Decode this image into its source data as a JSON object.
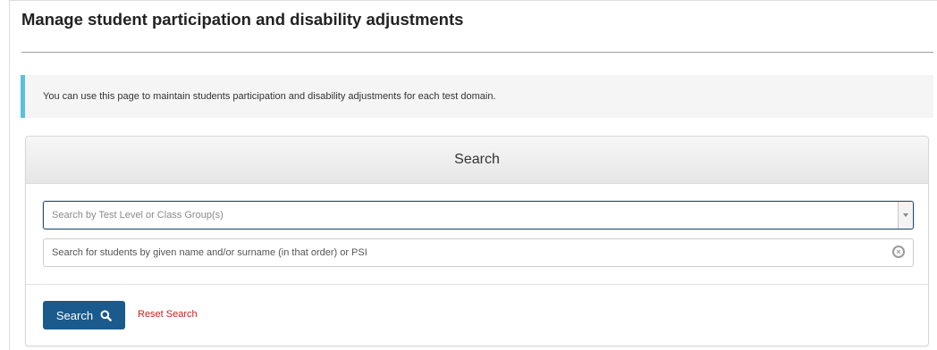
{
  "page": {
    "title": "Manage student participation and disability adjustments"
  },
  "info": {
    "text": "You can use this page to maintain students participation and disability adjustments for each test domain."
  },
  "search_panel": {
    "heading": "Search",
    "level_select": {
      "placeholder": "Search by Test Level or Class Group(s)",
      "value": "",
      "icon": "chevron-down-icon"
    },
    "student_input": {
      "placeholder": "Search for students by given name and/or surname (in that order) or PSI",
      "value": "",
      "clear_icon": "clear-icon"
    },
    "search_button": {
      "label": "Search",
      "icon": "search-icon"
    },
    "reset_label": "Reset Search"
  },
  "colors": {
    "info_accent": "#5bc0de",
    "primary_button": "#1a5a8c",
    "reset_link": "#d21b1b",
    "focus_border": "#1f4e79"
  }
}
